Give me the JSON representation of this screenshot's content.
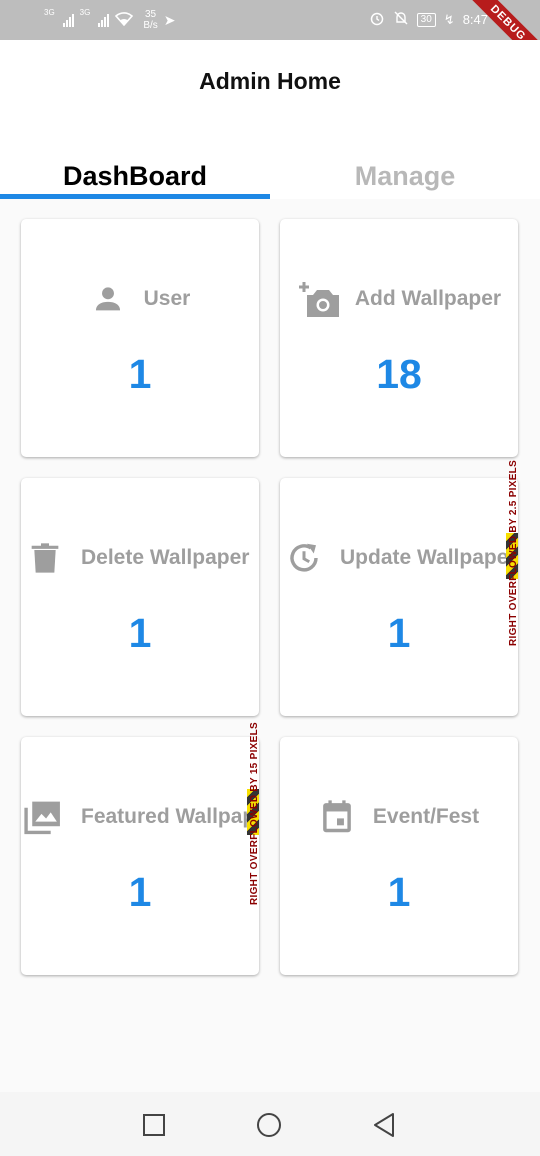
{
  "status_bar": {
    "network1": "3G",
    "network2": "3G",
    "speed_value": "35",
    "speed_unit": "B/s",
    "battery": "30",
    "time": "8:47"
  },
  "debug_banner": "DEBUG",
  "app_bar": {
    "title": "Admin Home"
  },
  "tabs": [
    {
      "label": "DashBoard",
      "active": true
    },
    {
      "label": "Manage",
      "active": false
    }
  ],
  "cards": [
    {
      "label": "User",
      "value": "1",
      "icon": "person-icon"
    },
    {
      "label": "Add Wallpaper",
      "value": "18",
      "icon": "add-photo-icon"
    },
    {
      "label": "Delete Wallpaper",
      "value": "1",
      "icon": "trash-icon"
    },
    {
      "label": "Update Wallpaper",
      "value": "1",
      "icon": "update-clock-icon"
    },
    {
      "label": "Featured Wallpaper",
      "value": "1",
      "icon": "photo-library-icon"
    },
    {
      "label": "Event/Fest",
      "value": "1",
      "icon": "calendar-icon"
    }
  ],
  "overflow_warnings": [
    "RIGHT OVERFLOWED BY 2.5 PIXELS",
    "RIGHT OVERFLOWED BY 15 PIXELS"
  ],
  "colors": {
    "accent": "#1e88e5",
    "label_grey": "#9e9e9e",
    "inactive_tab": "#b8b8b8",
    "debug_red": "#b71c1c"
  },
  "nav_bar": {
    "buttons": [
      "recents-square-icon",
      "home-circle-icon",
      "back-triangle-icon"
    ]
  }
}
